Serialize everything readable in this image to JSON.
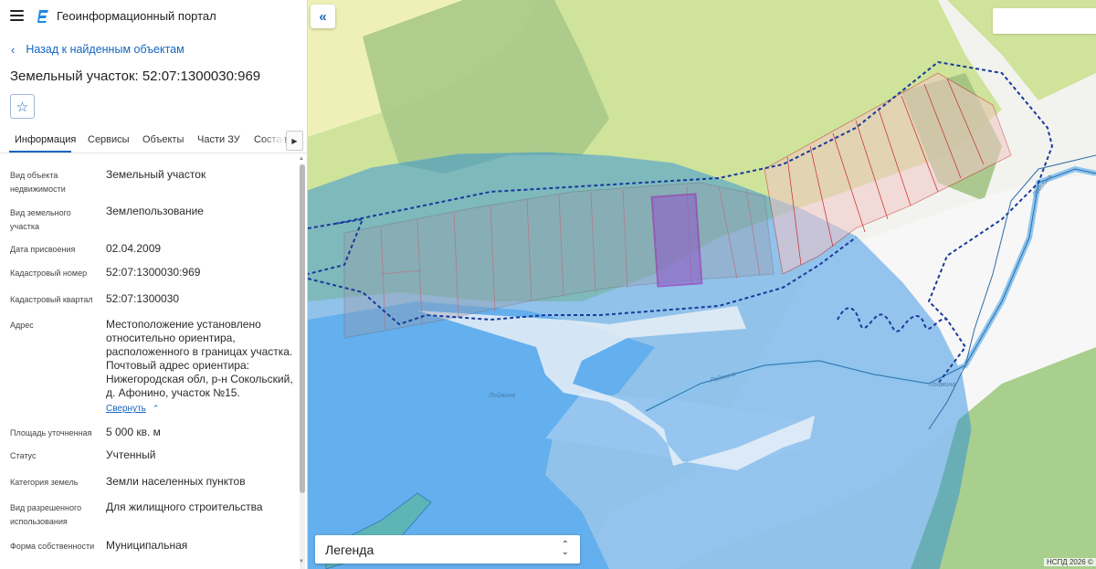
{
  "app": {
    "title": "Геоинформационный портал"
  },
  "nav": {
    "back_label": "Назад к найденным объектам"
  },
  "object": {
    "title": "Земельный участок: 52:07:1300030:969"
  },
  "tabs": [
    {
      "label": "Информация",
      "active": true
    },
    {
      "label": "Сервисы"
    },
    {
      "label": "Объекты"
    },
    {
      "label": "Части ЗУ"
    },
    {
      "label": "Состав"
    }
  ],
  "properties": [
    {
      "label": "Вид объекта недвижимости",
      "value": "Земельный участок"
    },
    {
      "label": "Вид земельного участка",
      "value": "Землепользование"
    },
    {
      "label": "Дата присвоения",
      "value": "02.04.2009"
    },
    {
      "label": "Кадастровый номер",
      "value": "52:07:1300030:969"
    },
    {
      "label": "Кадастровый квартал",
      "value": "52:07:1300030"
    },
    {
      "label": "Адрес",
      "value": "Местоположение установлено относительно ориентира, расположенного в границах участка. Почтовый адрес ориентира: Нижегородская обл, р-н Сокольский, д. Афонино, участок №15."
    },
    {
      "label": "Площадь уточненная",
      "value": "5 000 кв. м"
    },
    {
      "label": "Статус",
      "value": "Учтенный"
    },
    {
      "label": "Категория земель",
      "value": "Земли населенных пунктов"
    },
    {
      "label": "Вид разрешенного использования",
      "value": "Для жилищного строительства"
    },
    {
      "label": "Форма собственности",
      "value": "Муниципальная"
    }
  ],
  "collapse_label": "Свернуть",
  "map": {
    "legend_label": "Легенда",
    "attribution": "НСПД 2026 ©",
    "river_labels": [
      "Лоймина",
      "Лоймина",
      "Лоймина",
      "Лоймина"
    ]
  },
  "colors": {
    "accent": "#1565c0",
    "water_zone": "#1e88e5",
    "selected_parcel": "#9c27b0",
    "parcel_lines": "#c62828"
  },
  "icons": {
    "menu": "hamburger-icon",
    "logo": "portal-logo-icon",
    "back": "chevron-left-icon",
    "favorite": "star-icon",
    "tab_scroll": "chevron-right-icon",
    "collapse_panel": "double-chevron-left-icon",
    "legend_toggle": "up-down-arrows-icon"
  }
}
